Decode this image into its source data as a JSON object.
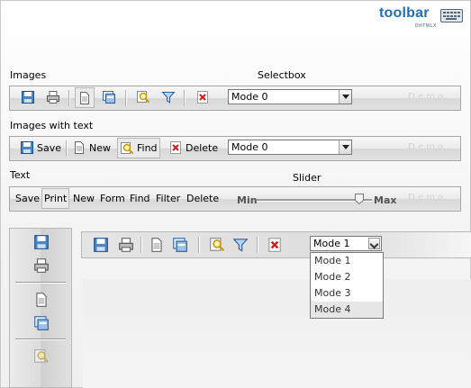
{
  "logo": {
    "name": "toolbar",
    "sub": "DHTMLX"
  },
  "labels": {
    "images": "Images",
    "selectbox": "Selectbox",
    "images_with_text": "Images with text",
    "text": "Text",
    "slider": "Slider"
  },
  "demo_watermark": "Demo",
  "toolbar_text": {
    "save": "Save",
    "new": "New",
    "find": "Find",
    "delete": "Delete"
  },
  "text_toolbar": {
    "items": [
      "Save",
      "Print",
      "New",
      "Form",
      "Find",
      "Filter",
      "Delete"
    ]
  },
  "slider": {
    "min_label": "Min",
    "max_label": "Max",
    "value_fraction": 0.89
  },
  "select1": {
    "value": "Mode 0"
  },
  "select2": {
    "value": "Mode 0"
  },
  "select3": {
    "value": "Mode 1",
    "options": [
      "Mode 1",
      "Mode 2",
      "Mode 3",
      "Mode 4"
    ],
    "highlighted": "Mode 4"
  },
  "colors": {
    "accent": "#1f6fb8",
    "disk_blue": "#3a76bb",
    "delete_red": "#d22020"
  },
  "icons": [
    "save-icon",
    "print-icon",
    "new-document-icon",
    "form-icon",
    "find-icon",
    "filter-icon",
    "delete-icon"
  ]
}
